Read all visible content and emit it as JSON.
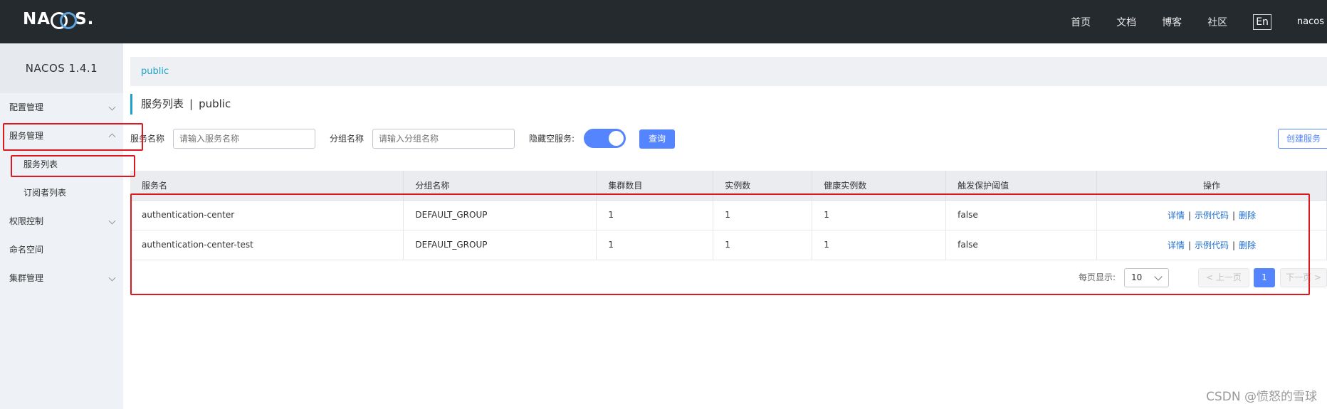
{
  "header": {
    "logo": "NACOS.",
    "nav": [
      "首页",
      "文档",
      "博客",
      "社区"
    ],
    "lang": "En",
    "user": "nacos"
  },
  "sidebar": {
    "title": "NACOS 1.4.1",
    "items": [
      {
        "label": "配置管理",
        "expand": "down"
      },
      {
        "label": "服务管理",
        "expand": "up"
      },
      {
        "label": "服务列表",
        "sub": true
      },
      {
        "label": "订阅者列表",
        "sub": true
      },
      {
        "label": "权限控制",
        "expand": "down"
      },
      {
        "label": "命名空间"
      },
      {
        "label": "集群管理",
        "expand": "down"
      }
    ]
  },
  "breadcrumb": "public",
  "page": {
    "title": "服务列表",
    "separator": "|",
    "namespace": "public"
  },
  "filters": {
    "service_name_label": "服务名称",
    "service_name_placeholder": "请输入服务名称",
    "group_name_label": "分组名称",
    "group_name_placeholder": "请输入分组名称",
    "hide_empty_label": "隐藏空服务:",
    "hide_empty_on": true,
    "query_button": "查询",
    "create_button": "创建服务"
  },
  "table": {
    "headers": [
      "服务名",
      "分组名称",
      "集群数目",
      "实例数",
      "健康实例数",
      "触发保护阈值",
      "操作"
    ],
    "rows": [
      [
        "authentication-center",
        "DEFAULT_GROUP",
        "1",
        "1",
        "1",
        "false"
      ],
      [
        "authentication-center-test",
        "DEFAULT_GROUP",
        "1",
        "1",
        "1",
        "false"
      ]
    ],
    "actions": [
      "详情",
      "示例代码",
      "删除"
    ],
    "action_separator": "|"
  },
  "pagination": {
    "per_page_label": "每页显示:",
    "per_page_value": "10",
    "prev_label": "< 上一页",
    "current_page": "1",
    "next_label": "下一页 >"
  },
  "watermark": "CSDN @愤怒的雪球",
  "colors": {
    "header_bg": "#252a2f",
    "accent": "#5584ff",
    "link": "#1f6fd0",
    "breadcrumb": "#1ba3c7",
    "annotation": "#e0181e"
  }
}
